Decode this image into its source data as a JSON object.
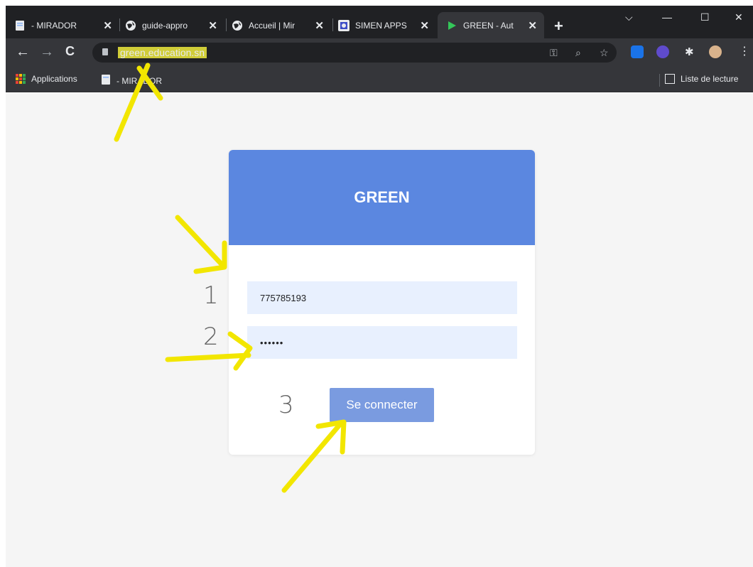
{
  "browser": {
    "tabs": [
      {
        "title": "- MIRADOR",
        "icon": "document-icon"
      },
      {
        "title": "guide-appro",
        "icon": "globe-icon"
      },
      {
        "title": "Accueil | Mir",
        "icon": "globe-icon"
      },
      {
        "title": "SIMEN APPS",
        "icon": "app-icon"
      },
      {
        "title": "GREEN - Aut",
        "icon": "play-icon",
        "active": true
      }
    ],
    "address": "green.education.sn",
    "bookmarks": {
      "apps_label": "Applications",
      "item_label": "- MIRADOR",
      "reading_list_label": "Liste de lecture"
    }
  },
  "login": {
    "title": "GREEN",
    "username_value": "775785193",
    "password_value": "••••••",
    "submit_label": "Se connecter"
  },
  "annotations": {
    "step1": "1",
    "step2": "2",
    "step3": "3",
    "color": "#f2e600"
  }
}
